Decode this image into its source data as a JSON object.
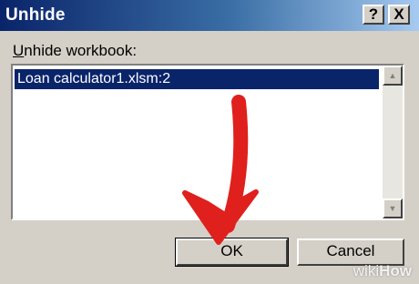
{
  "window": {
    "title": "Unhide",
    "help_label": "?",
    "close_label": "X"
  },
  "dialog": {
    "label_prefix": "U",
    "label_rest": "nhide workbook:",
    "items": [
      "Loan calculator1.xlsm:2"
    ],
    "selected_index": 0
  },
  "buttons": {
    "ok": "OK",
    "cancel": "Cancel"
  },
  "scrollbar": {
    "up_icon": "triangle-up",
    "down_icon": "triangle-down"
  },
  "annotation": {
    "type": "red-arrow",
    "color": "#e0201c"
  },
  "watermark": {
    "part1": "wiki",
    "part2": "How"
  },
  "colors": {
    "title_bar_start": "#0a246a",
    "title_bar_end": "#a6caf0",
    "selection": "#0a246a",
    "dialog_bg": "#d4d0c8"
  }
}
